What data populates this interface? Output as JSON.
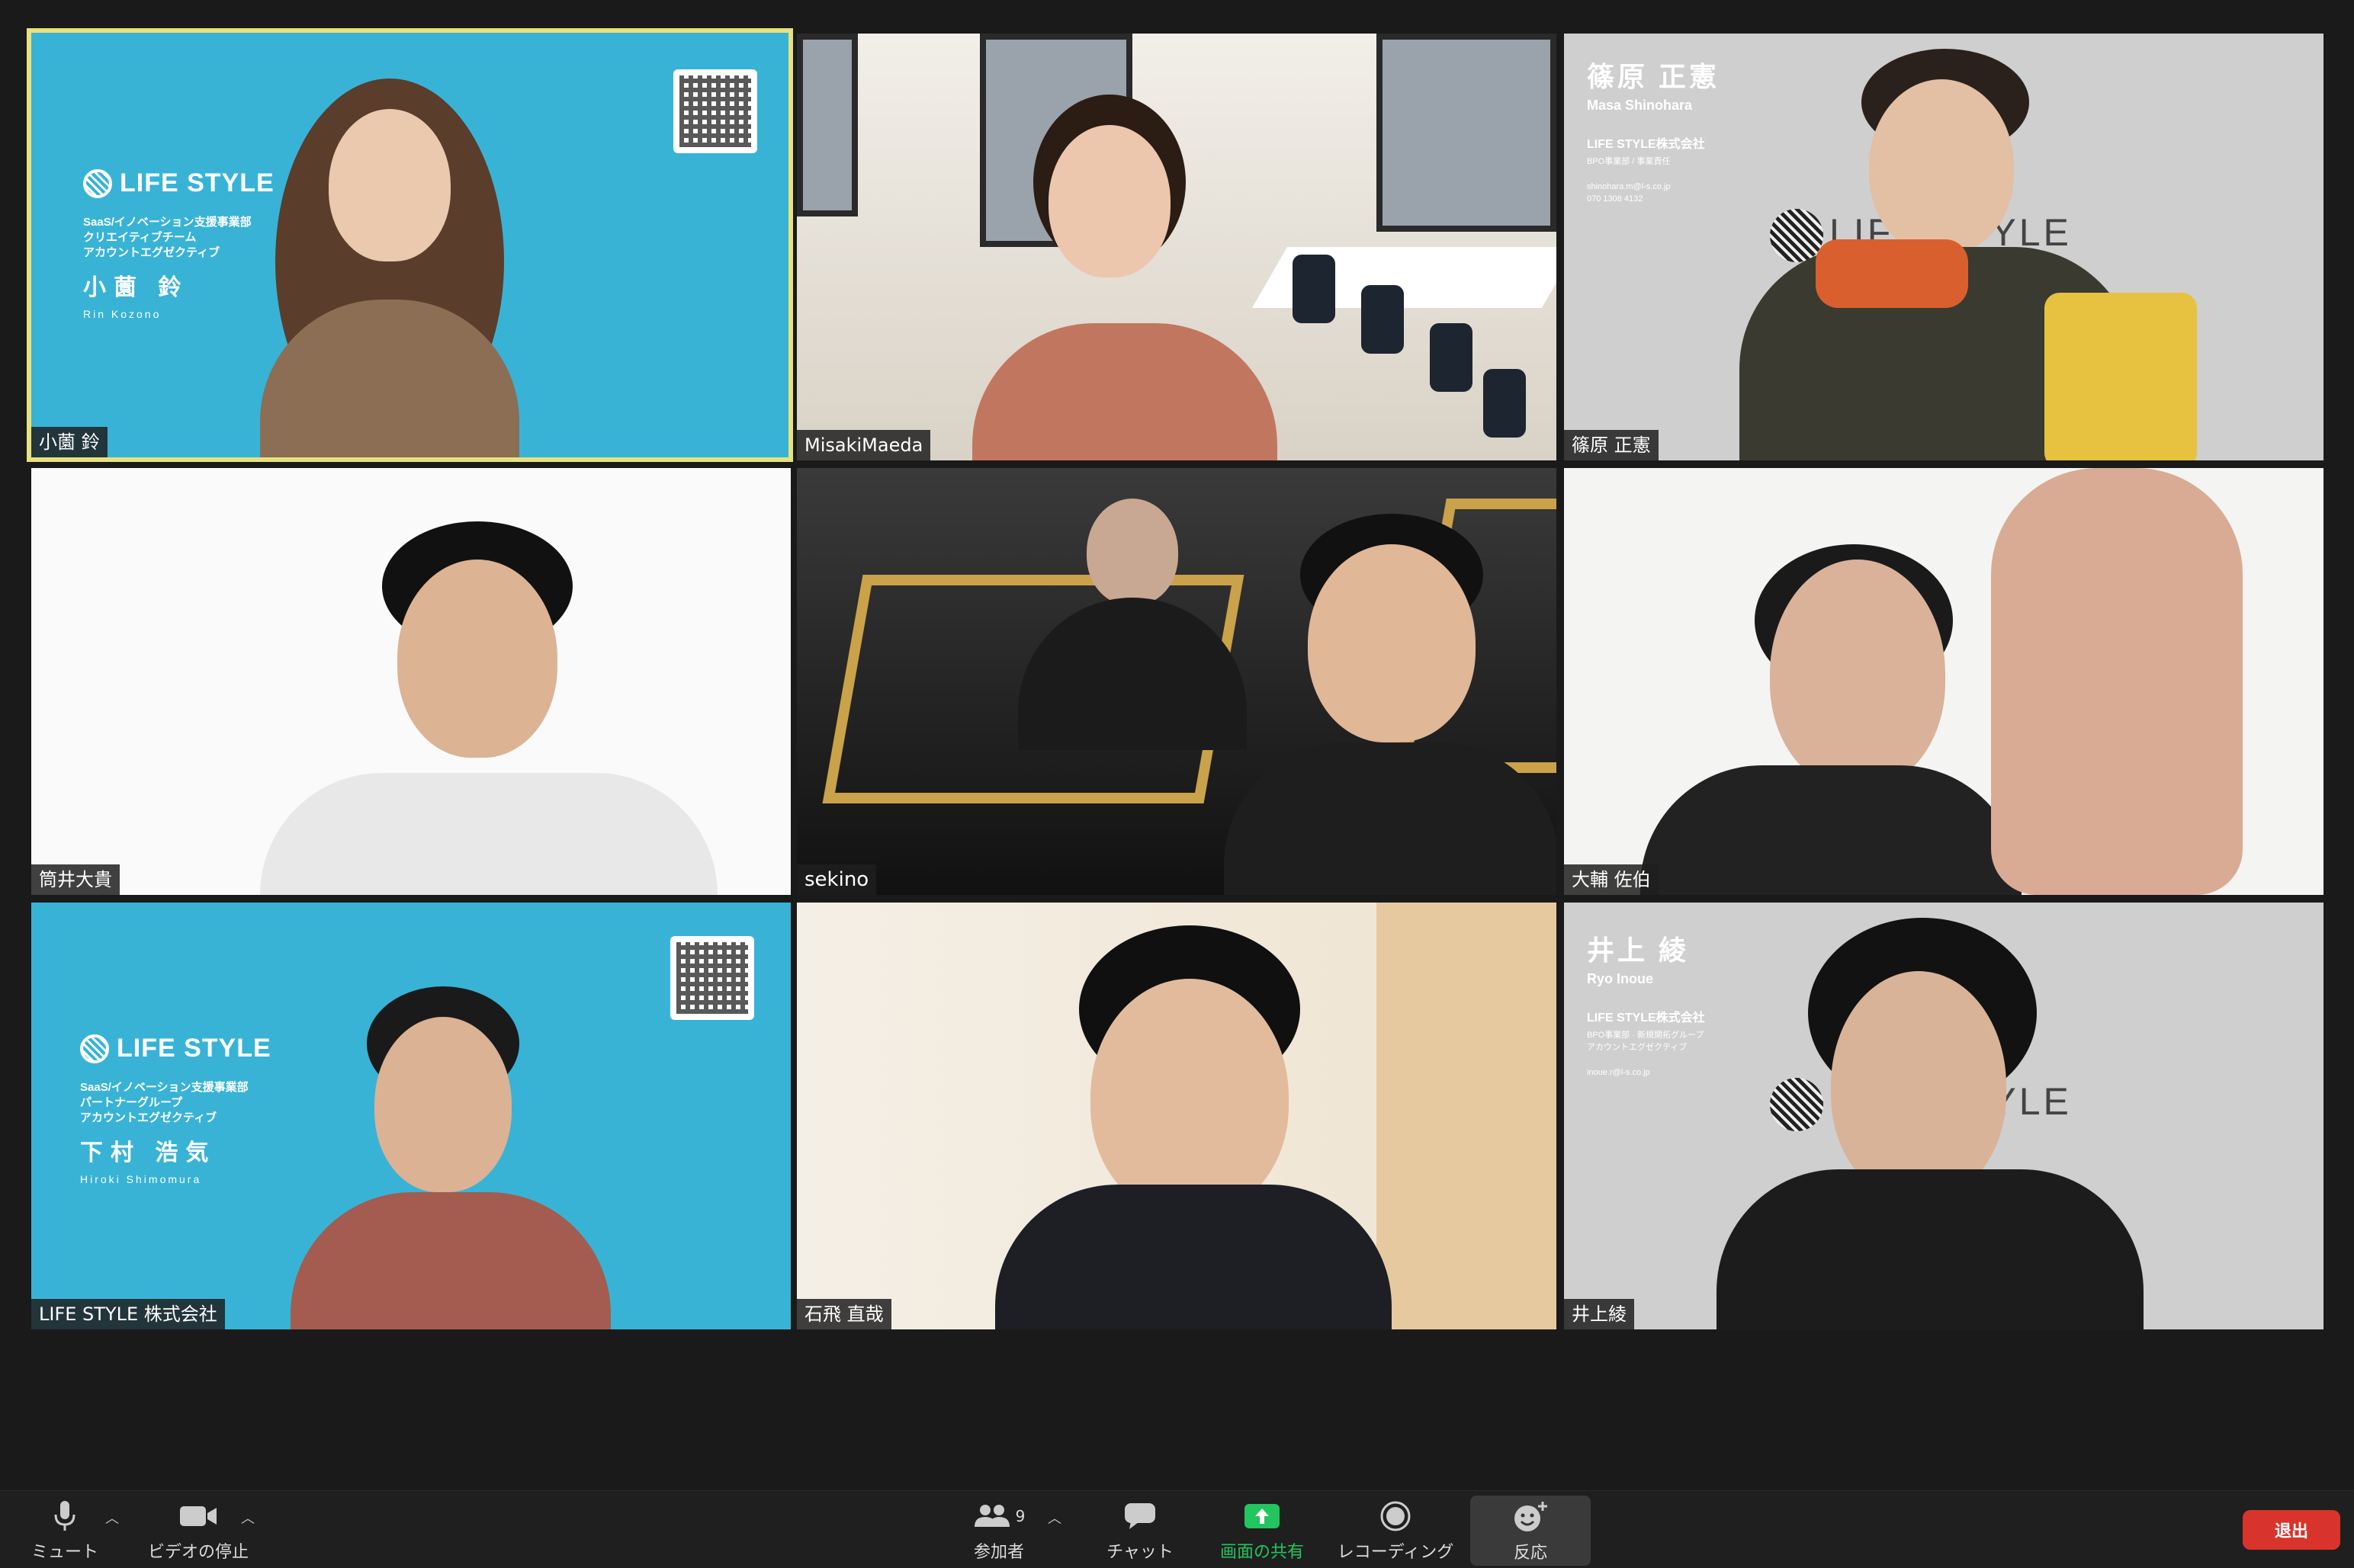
{
  "participants": [
    {
      "name": "小薗 鈴",
      "active": true
    },
    {
      "name": "MisakiMaeda"
    },
    {
      "name": "篠原 正憲"
    },
    {
      "name": "筒井大貴"
    },
    {
      "name": "sekino"
    },
    {
      "name": "大輔 佐伯"
    },
    {
      "name": "LIFE STYLE 株式会社"
    },
    {
      "name": "石飛 直哉"
    },
    {
      "name": "井上綾"
    }
  ],
  "backgrounds": {
    "tile1": {
      "logo": "LIFE STYLE",
      "dept_line1": "SaaS/イノベーション支援事業部",
      "dept_line2": "クリエイティブチーム",
      "dept_line3": "アカウントエグゼクティブ",
      "name_jp": "小薗 鈴",
      "name_en": "Rin Kozono"
    },
    "tile3": {
      "name_jp": "篠原 正憲",
      "name_en": "Masa Shinohara",
      "company": "LIFE STYLE株式会社",
      "sub": "BPO事業部 / 事業責任",
      "mail": "shinohara.m@l-s.co.jp",
      "phone": "070 1308 4132",
      "logo": "LIFE STYLE"
    },
    "tile7": {
      "logo": "LIFE STYLE",
      "dept_line1": "SaaS/イノベーション支援事業部",
      "dept_line2": "パートナーグループ",
      "dept_line3": "アカウントエグゼクティブ",
      "name_jp": "下村 浩気",
      "name_en": "Hiroki Shimomura"
    },
    "tile9": {
      "name_jp": "井上 綾",
      "name_en": "Ryo Inoue",
      "company": "LIFE STYLE株式会社",
      "sub1": "BPO事業部 · 新規開拓グループ",
      "sub2": "アカウントエグゼクティブ",
      "mail": "inoue.r@l-s.co.jp",
      "logo": "LIFE STYLE"
    }
  },
  "toolbar": {
    "mute_label": "ミュート",
    "video_label": "ビデオの停止",
    "participants_label": "参加者",
    "participants_count": "9",
    "chat_label": "チャット",
    "share_label": "画面の共有",
    "record_label": "レコーディング",
    "reactions_label": "反応",
    "leave_label": "退出"
  },
  "colors": {
    "active_border": "#e7e27f",
    "share_green": "#22c55e",
    "leave_red": "#d9342b",
    "brand_blue": "#38b3d6"
  }
}
